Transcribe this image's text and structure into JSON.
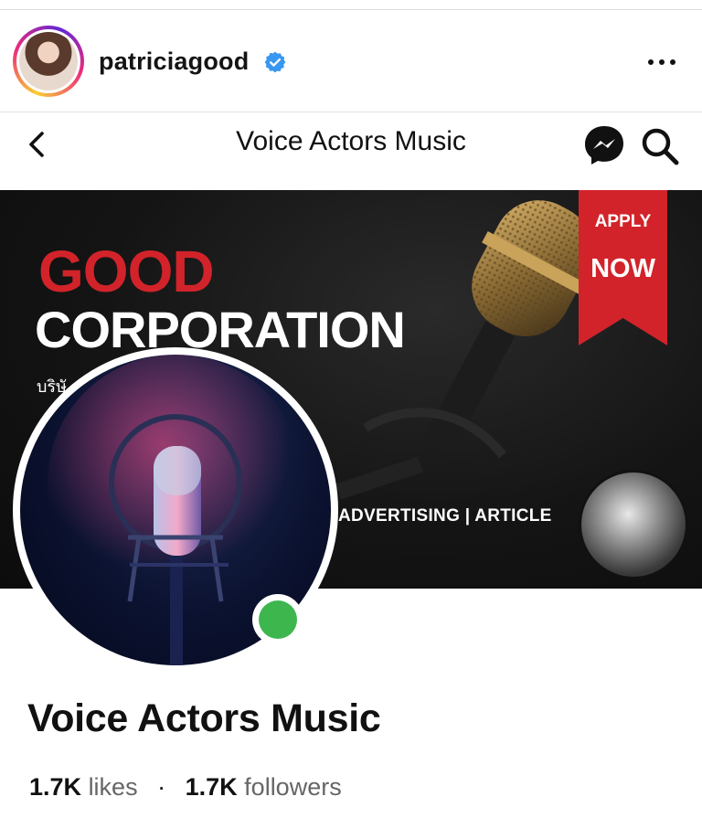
{
  "post": {
    "username": "patriciagood",
    "verified": true
  },
  "page_nav": {
    "title": "Voice Actors Music"
  },
  "cover": {
    "headline_red": "GOOD",
    "headline_white": "CORPORATION",
    "thai_text": "บริษั",
    "ribbon_top": "APPLY",
    "ribbon_bottom": "NOW",
    "tagline": "ADVERTISING | ARTICLE"
  },
  "page": {
    "name": "Voice Actors Music",
    "likes_count": "1.7K",
    "likes_label": "likes",
    "separator": "·",
    "followers_count": "1.7K",
    "followers_label": "followers"
  },
  "colors": {
    "brand_red": "#d2232a",
    "online_green": "#3db64e",
    "verified_blue": "#3897f0"
  },
  "icons": [
    "verified-badge-icon",
    "more-options-icon",
    "back-arrow-icon",
    "messenger-icon",
    "search-icon"
  ]
}
